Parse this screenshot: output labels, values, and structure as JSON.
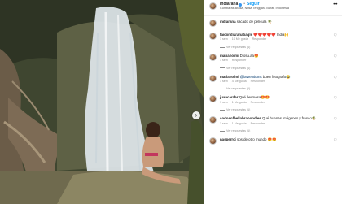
{
  "post": {
    "carousel_next": "›"
  },
  "header": {
    "username": "indiarana",
    "dot": "•",
    "follow": "Seguir",
    "location": "Cumbaras Brasa, Nusa Tenggara Barat, Indonesia",
    "more": "•••"
  },
  "caption": {
    "username": "indiarana",
    "text": "sacado de película 🌴"
  },
  "comments": [
    {
      "username": "faicondiaranatiagle",
      "text": "❤️❤️❤️❤️❤️ India🙌",
      "time": "1 sem",
      "likes": "10 Me gusta",
      "reply": "Responder",
      "replies": "Ver respuestas (1)"
    },
    {
      "username": "marianoimi",
      "text": "Diosa.aa😍",
      "time": "1 sem",
      "likes": "",
      "reply": "Responder",
      "replies": "Ver respuestas (1)"
    },
    {
      "username": "marianoimi",
      "mention": "@lavrentitons",
      "text": "buen fotografo😂",
      "time": "1 sem",
      "likes": "4 Me gusta",
      "reply": "Responder",
      "replies": "Ver respuestas (1)"
    },
    {
      "username": "juancarder",
      "text": "Qué hermosa😍😍",
      "time": "1 sem",
      "likes": "1 Me gusta",
      "reply": "Responder",
      "replies": "Ver respuestas (1)"
    },
    {
      "username": "sodosofbellabrabondles",
      "text": "Qué buenas imágenes y fresco🌴",
      "time": "1 sem",
      "likes": "1 Me gusta",
      "reply": "Responder",
      "replies": "Ver respuestas (1)"
    },
    {
      "username": "nasperrcj",
      "text": "sos de otro mundo 😍😍",
      "time": "",
      "likes": "",
      "reply": "",
      "replies": ""
    }
  ],
  "icons": {
    "heart": "♡"
  }
}
